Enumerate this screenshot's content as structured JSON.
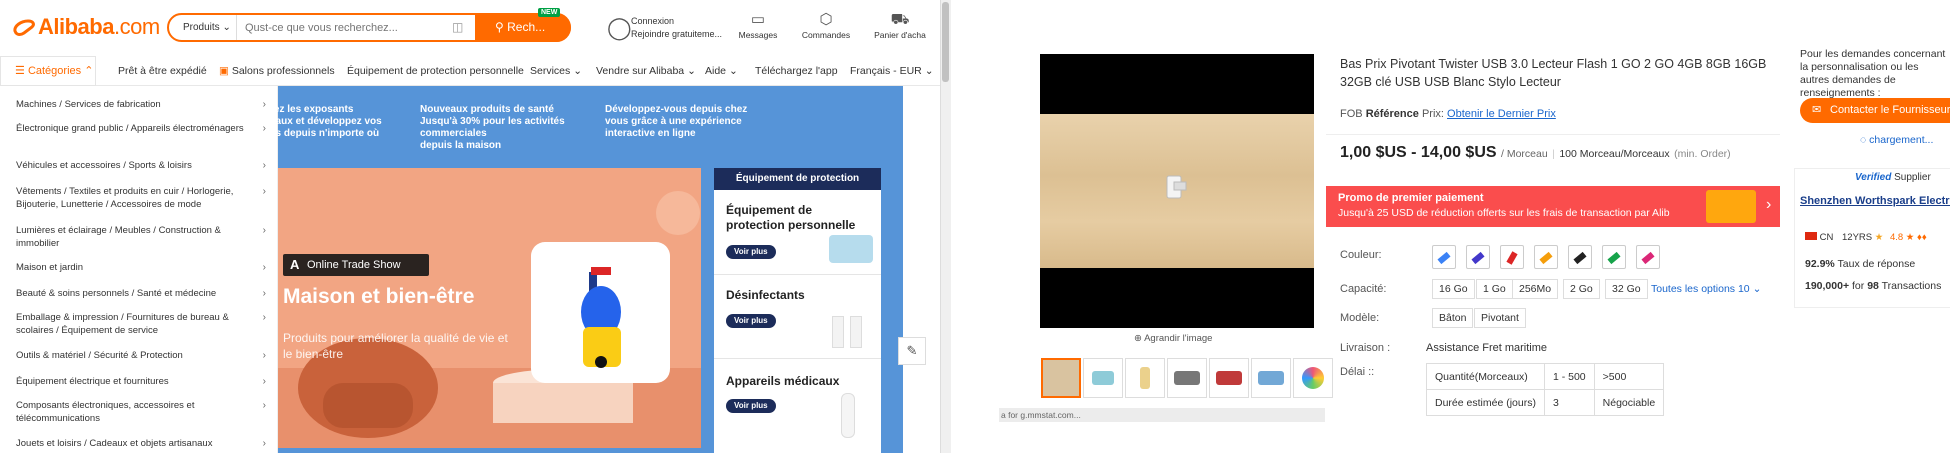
{
  "header": {
    "logo_text": "Alibaba",
    "logo_domain": ".com",
    "search_category": "Produits",
    "search_placeholder": "Qust-ce que vous recherchez...",
    "search_button": "Rech...",
    "new_badge": "NEW",
    "account_line1": "Connexion",
    "account_line2": "Rejoindre gratuiteme...",
    "messages": "Messages",
    "orders": "Commandes",
    "cart": "Panier d'acha"
  },
  "nav": {
    "categories": "Catégories",
    "items": [
      "Prêt à être expédié",
      "Salons professionnels",
      "Équipement de protection personnelle",
      "Services",
      "Vendre sur Alibaba",
      "Aide",
      "Téléchargez l'app",
      "Français - EUR"
    ]
  },
  "categories": [
    "Machines / Services de fabrication",
    "Électronique grand public / Appareils électroménagers",
    "Véhicules et accessoires / Sports & loisirs",
    "Vêtements / Textiles et produits en cuir / Horlogerie, Bijouterie, Lunetterie / Accessoires de mode",
    "Lumières et éclairage / Meubles / Construction & immobilier",
    "Maison et jardin",
    "Beauté & soins personnels / Santé et médecine",
    "Emballage & impression / Fournitures de bureau & scolaires / Équipement de service",
    "Outils & matériel / Sécurité & Protection",
    "Équipement électrique et fournitures",
    "Composants électroniques, accessoires et télécommunications",
    "Jouets et loisirs / Cadeaux et objets artisanaux"
  ],
  "banner": {
    "col1": [
      "rez les exposants",
      "eaux et développez vos",
      "es depuis n'importe où"
    ],
    "col2": [
      "Nouveaux produits de santé",
      "Jusqu'à 30% pour les activités commerciales",
      "depuis la maison"
    ],
    "col3": [
      "Développez-vous depuis chez",
      "vous grâce à une expérience",
      "interactive en ligne"
    ]
  },
  "promo": {
    "badge": "Online Trade Show",
    "title": "Maison et bien-être",
    "subtitle": "Produits pour améliorer la qualité de vie et le bien-être"
  },
  "side": {
    "header": "Équipement de protection",
    "items": [
      {
        "title": "Équipement de protection personnelle",
        "cta": "Voir plus"
      },
      {
        "title": "Désinfectants",
        "cta": "Voir plus"
      },
      {
        "title": "Appareils médicaux",
        "cta": "Voir plus"
      }
    ]
  },
  "product": {
    "title": "Bas Prix Pivotant Twister USB 3.0 Lecteur Flash 1 GO 2 GO 4GB 8GB 16GB 32GB clé USB USB Blanc Stylo Lecteur",
    "fob_label": "FOB",
    "ref_label": "Référence",
    "prix_label": "Prix:",
    "price_link": "Obtenir le Dernier Prix",
    "price": "1,00 $US - 14,00 $US",
    "unit": "/ Morceau",
    "moq": "100 Morceau/Morceaux",
    "moq_note": "(min. Order)",
    "zoom": "Agrandir l'image",
    "status_url": "a for g.mmstat.com..."
  },
  "promo_bar": {
    "title": "Promo de premier paiement",
    "text": "Jusqu'à 25 USD de réduction offerts sur les frais de transaction par Alib"
  },
  "specs": {
    "color_label": "Couleur:",
    "capacity_label": "Capacité:",
    "capacities": [
      "16 Go",
      "1 Go",
      "256Mo",
      "2 Go",
      "32 Go"
    ],
    "all_options": "Toutes les options 10",
    "model_label": "Modèle:",
    "models": [
      "Bâton",
      "Pivotant"
    ],
    "shipping_label": "Livraison :",
    "shipping_value": "Assistance Fret maritime",
    "delay_label": "Délai ::",
    "delay_table": [
      [
        "Quantité(Morceaux)",
        "1 - 500",
        ">500"
      ],
      [
        "Durée estimée (jours)",
        "3",
        "Négociable"
      ]
    ]
  },
  "right_col": {
    "text": "Pour les demandes concernant la personnalisation ou les autres demandes de renseignements :",
    "contact": "Contacter le Fournisseur",
    "loading": "chargement...",
    "verified": "Verified",
    "supplier": "Supplier",
    "company": "Shenzhen Worthspark Electronic",
    "country": "CN",
    "years": "12YRS",
    "rating": "4.8",
    "response_pct": "92.9%",
    "response_label": "Taux de réponse",
    "transactions_amount": "190,000+",
    "transactions_for": "for",
    "transactions_count": "98",
    "transactions_label": "Transactions"
  },
  "colors": {
    "brand": "#ff6a00",
    "navy": "#1c2c5a",
    "banner_blue": "#5694d8",
    "promo_red": "#fa4d4d",
    "link": "#1a66cc"
  }
}
